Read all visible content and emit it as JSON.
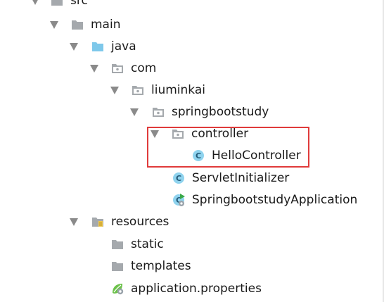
{
  "tree": {
    "src": {
      "label": "src",
      "icon": "folder-icon"
    },
    "main": {
      "label": "main",
      "icon": "folder-icon"
    },
    "java": {
      "label": "java",
      "icon": "source-folder-icon"
    },
    "com": {
      "label": "com",
      "icon": "package-icon"
    },
    "liuminkai": {
      "label": "liuminkai",
      "icon": "package-icon"
    },
    "springbootstudy": {
      "label": "springbootstudy",
      "icon": "package-icon"
    },
    "controller": {
      "label": "controller",
      "icon": "package-icon"
    },
    "hello_controller": {
      "label": "HelloController",
      "icon": "class-icon",
      "badge": "C"
    },
    "servlet_initializer": {
      "label": "ServletInitializer",
      "icon": "class-icon",
      "badge": "C"
    },
    "application": {
      "label": "SpringbootstudyApplication",
      "icon": "spring-boot-class-icon",
      "badge": "C"
    },
    "resources": {
      "label": "resources",
      "icon": "resources-folder-icon"
    },
    "static": {
      "label": "static",
      "icon": "folder-icon"
    },
    "templates": {
      "label": "templates",
      "icon": "folder-icon"
    },
    "application_properties": {
      "label": "application.properties",
      "icon": "spring-properties-icon"
    }
  },
  "colors": {
    "folder": "#a5a9ad",
    "source_folder": "#7ec8ea",
    "class_circle": "#8fd3ee",
    "class_letter": "#245a78",
    "highlight_border": "#e03b3b",
    "arrow": "#8a8a8a"
  }
}
